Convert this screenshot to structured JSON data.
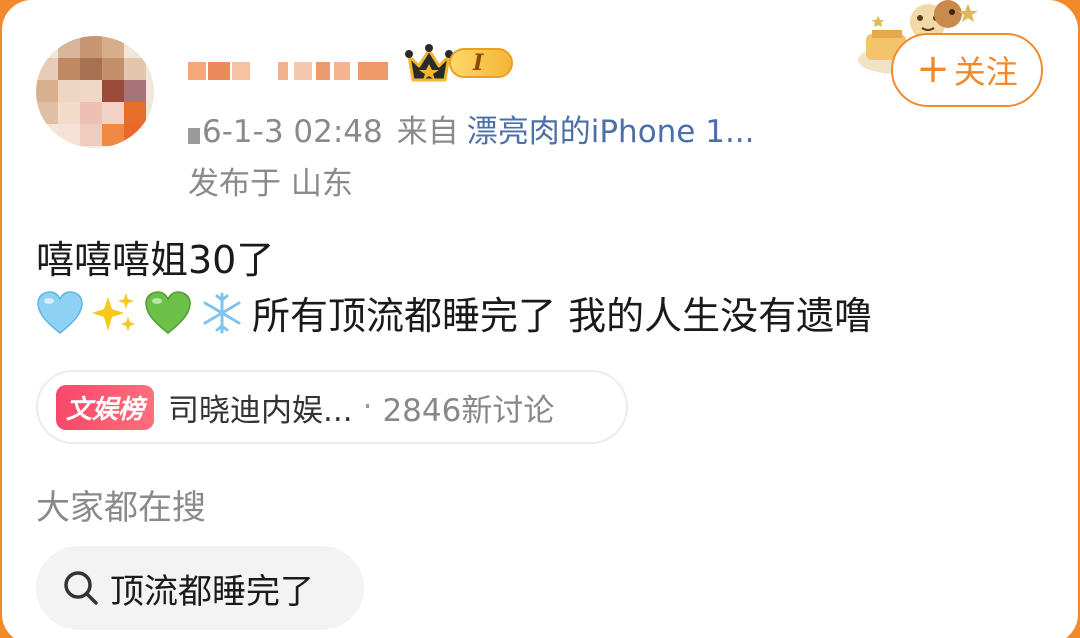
{
  "post": {
    "timestamp": "6-1-3 02:48",
    "from_label": "来自",
    "device": "漂亮肉的iPhone 1...",
    "location": "发布于 山东",
    "text_line1": "嘻嘻嘻姐30了",
    "text_line2": "所有顶流都睡完了 我的人生没有遗噜",
    "emojis": [
      "light-blue-heart-icon",
      "sparkles-icon",
      "green-heart-icon",
      "snowflake-icon"
    ]
  },
  "user": {
    "level": "I"
  },
  "follow": {
    "plus": "+",
    "label": "关注"
  },
  "topic": {
    "badge": "文娱榜",
    "name": "司晓迪内娱...",
    "separator": "·",
    "count": "2846新讨论"
  },
  "search": {
    "heading": "大家都在搜",
    "query": "顶流都睡完了"
  },
  "colors": {
    "accent": "#f08a2b",
    "link": "#4b6fa6",
    "badge": "#f7476a",
    "meta": "#8a8a8a"
  }
}
